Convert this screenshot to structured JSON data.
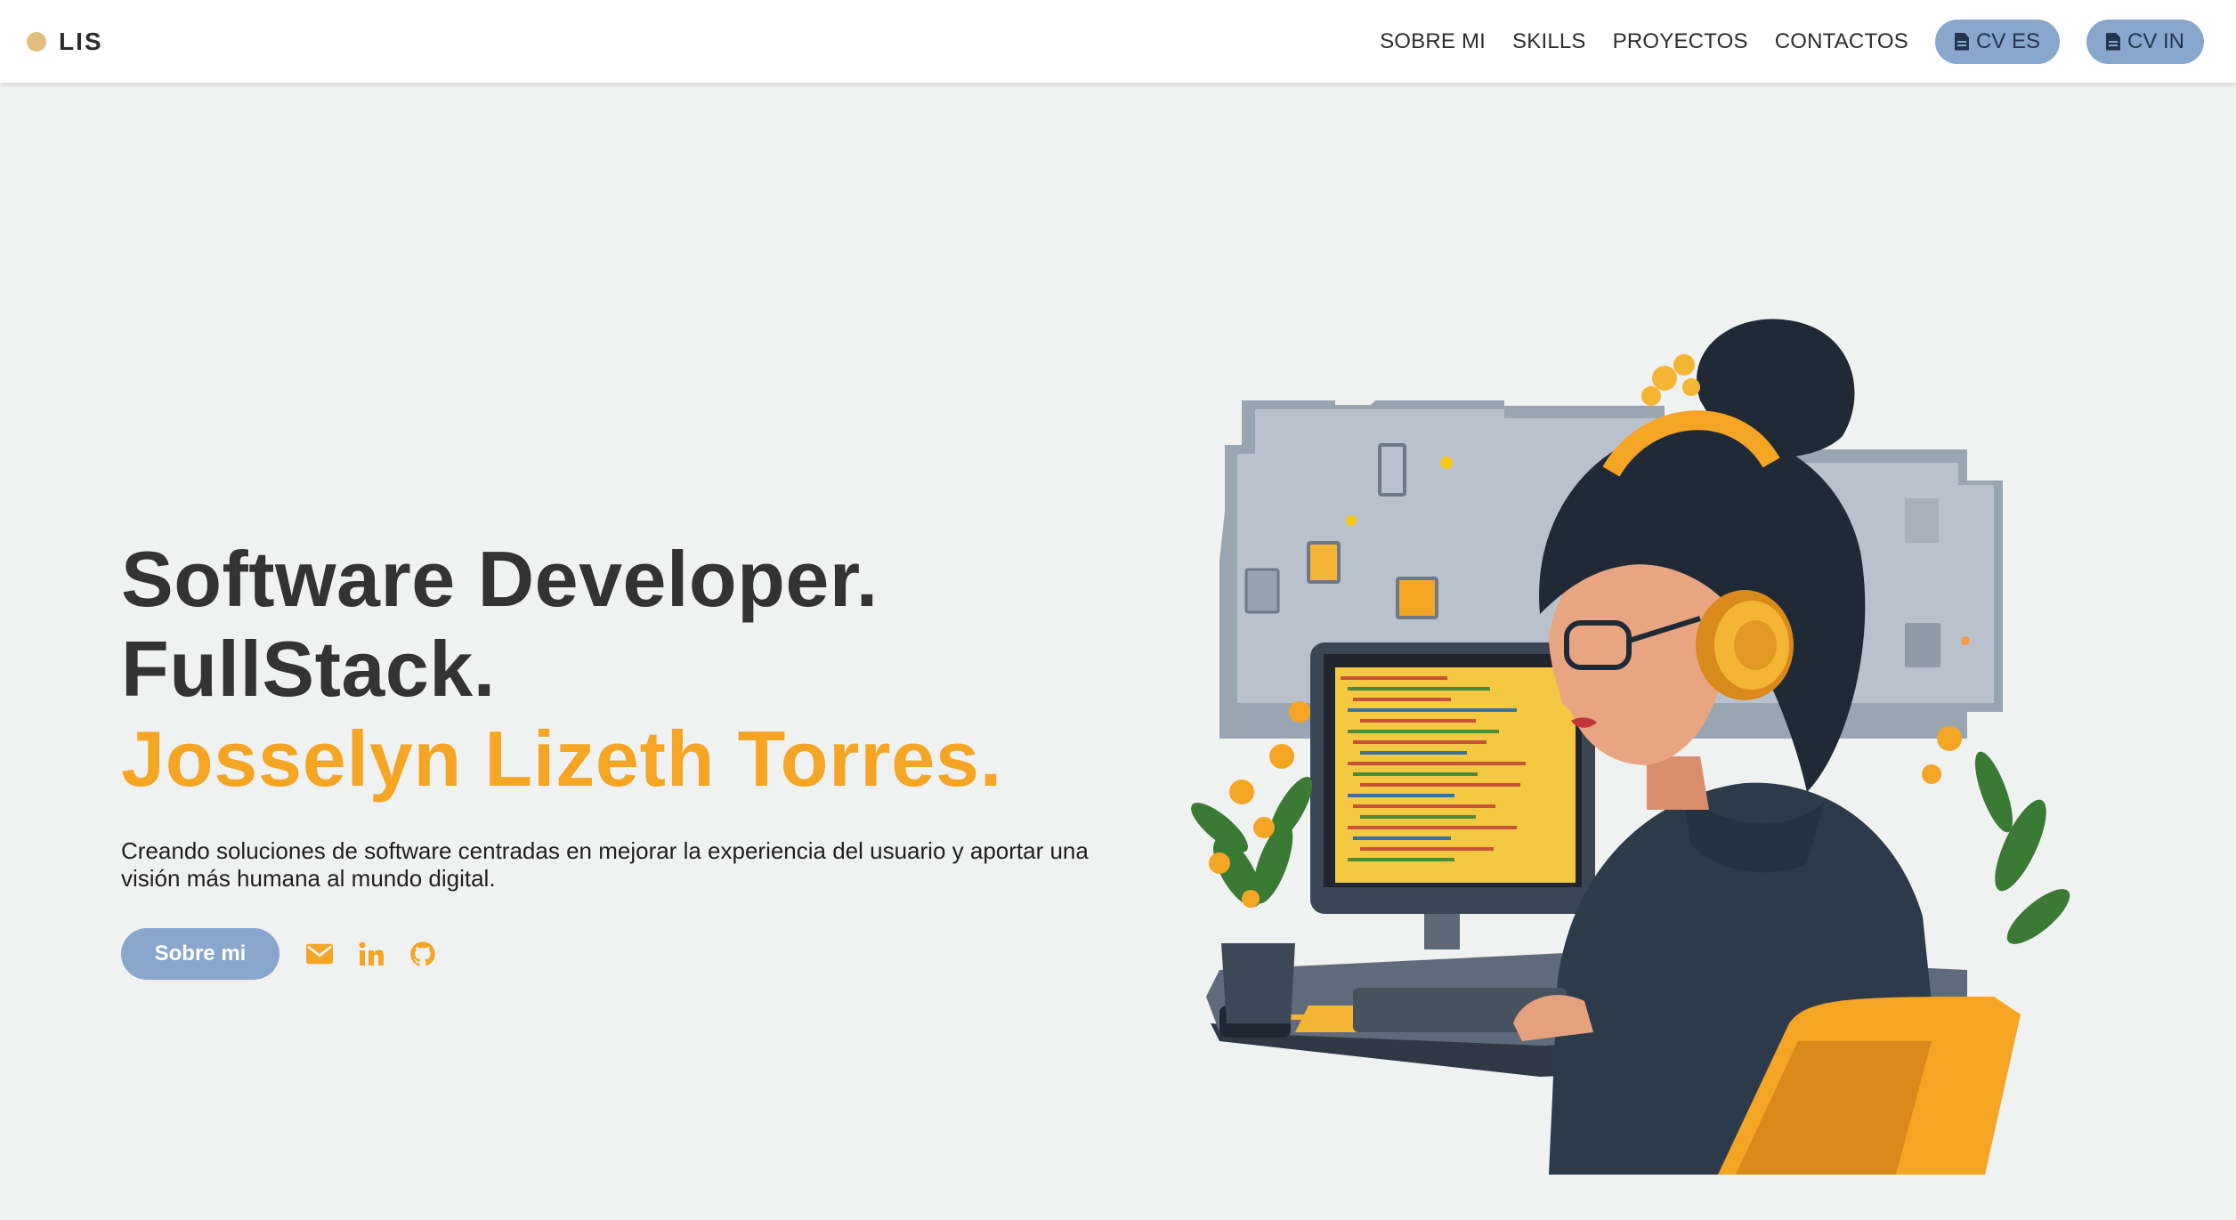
{
  "navbar": {
    "brand": "LIS",
    "links": [
      "SOBRE MI",
      "SKILLS",
      "PROYECTOS",
      "CONTACTOS"
    ],
    "cv_buttons": [
      "CV ES",
      "CV IN"
    ],
    "accent_color": "#89a6cc",
    "brand_dot_color": "#e3bd80"
  },
  "hero": {
    "line1": "Software Developer.",
    "line2": "FullStack.",
    "name": "Josselyn Lizeth Torres.",
    "description": "Creando soluciones de software centradas en mejorar la experiencia del usuario y aportar una visión más humana al mundo digital.",
    "primary_button": "Sobre mi",
    "social_icons": [
      "envelope-icon",
      "linkedin-icon",
      "github-icon"
    ],
    "name_color": "#f5a524"
  },
  "illustration": {
    "subject": "developer-illustration"
  }
}
